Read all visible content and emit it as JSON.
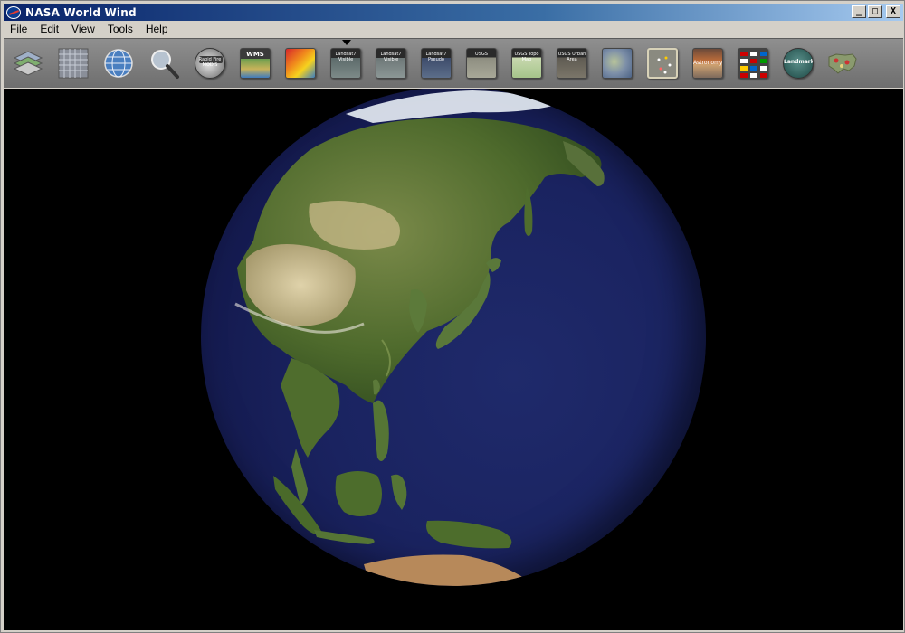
{
  "window": {
    "title": "NASA World Wind",
    "buttons": {
      "minimize": "_",
      "maximize": "□",
      "close": "X"
    }
  },
  "menu": {
    "items": [
      {
        "id": "file",
        "label": "File"
      },
      {
        "id": "edit",
        "label": "Edit"
      },
      {
        "id": "view",
        "label": "View"
      },
      {
        "id": "tools",
        "label": "Tools"
      },
      {
        "id": "help",
        "label": "Help"
      }
    ]
  },
  "toolbar": {
    "tools": [
      {
        "name": "layer-manager-icon"
      },
      {
        "name": "lat-lon-grid-icon"
      },
      {
        "name": "globe-icon"
      },
      {
        "name": "search-icon"
      },
      {
        "name": "rapid-fire-modis-icon",
        "label": "Rapid Fire MODIS"
      },
      {
        "name": "wms-browser-icon",
        "label": "WMS"
      },
      {
        "name": "scientific-visualization-icon"
      },
      {
        "name": "landsat-visible-icon",
        "label": "Landsat7 Visible",
        "active": true
      },
      {
        "name": "landsat-visible-wms-icon",
        "label": "Landsat7 Visible"
      },
      {
        "name": "landsat-pseudo-icon",
        "label": "Landsat7 Pseudo"
      },
      {
        "name": "usgs-urban-ortho-icon",
        "label": "USGS"
      },
      {
        "name": "usgs-topo-map-icon",
        "label": "USGS Topo Map"
      },
      {
        "name": "usgs-urban-area-icon",
        "label": "USGS Urban Area"
      },
      {
        "name": "blue-marble-icon"
      },
      {
        "name": "place-names-icon"
      },
      {
        "name": "astronomy-icon",
        "label": "Astronomy"
      },
      {
        "name": "flags-icon"
      },
      {
        "name": "landmarks-icon",
        "label": "Landmarks"
      },
      {
        "name": "us-map-icon"
      }
    ]
  }
}
